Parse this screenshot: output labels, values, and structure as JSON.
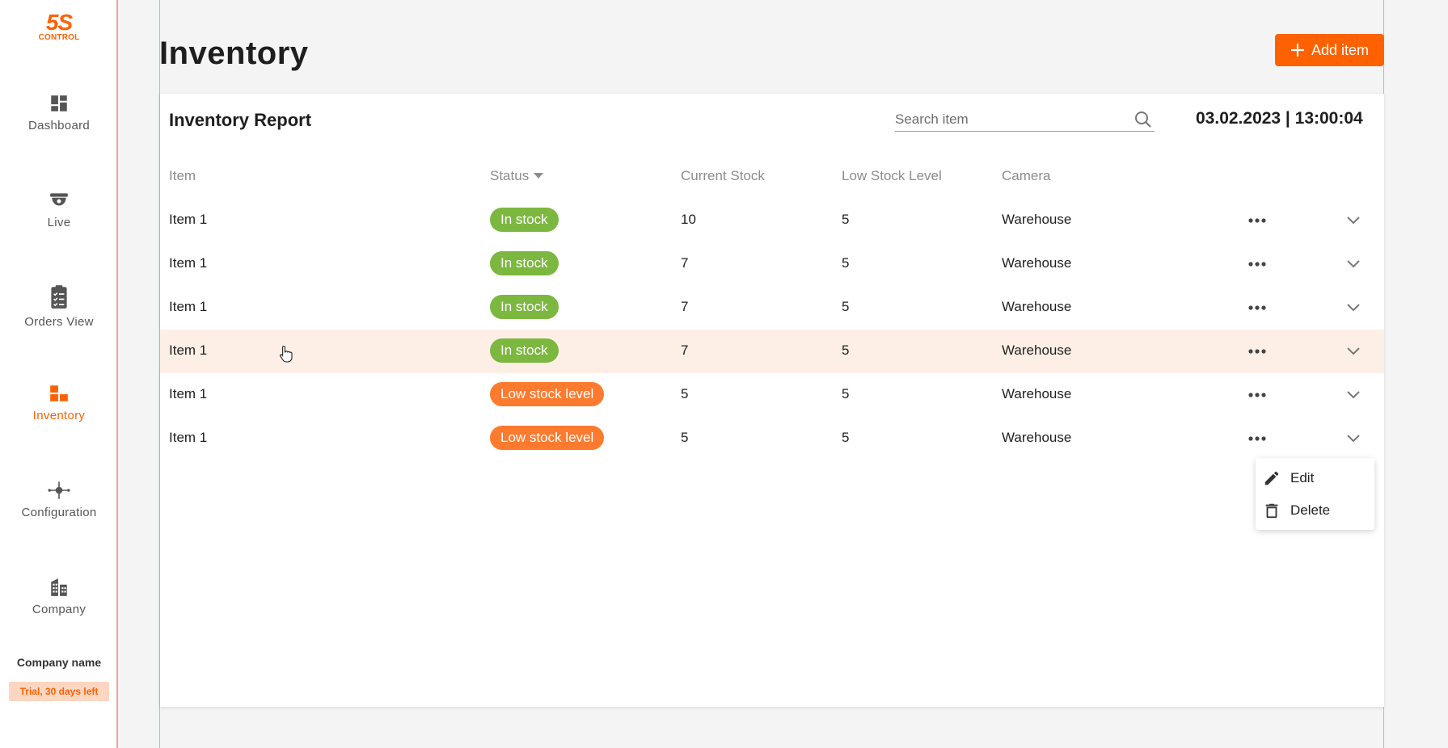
{
  "logo": {
    "main": "5S",
    "sub": "CONTROL"
  },
  "sidebar": {
    "items": [
      {
        "label": "Dashboard",
        "icon": "dashboard-icon"
      },
      {
        "label": "Live",
        "icon": "camera-icon"
      },
      {
        "label": "Orders View",
        "icon": "clipboard-icon"
      },
      {
        "label": "Inventory",
        "icon": "inventory-icon",
        "active": true
      },
      {
        "label": "Configuration",
        "icon": "configuration-icon"
      },
      {
        "label": "Company",
        "icon": "building-icon"
      }
    ],
    "company_name": "Company name",
    "trial": "Trial, 30 days left"
  },
  "header": {
    "title": "Inventory",
    "add_button": "Add item"
  },
  "report": {
    "title": "Inventory Report",
    "search_placeholder": "Search item",
    "datetime": "03.02.2023 | 13:00:04",
    "columns": [
      "Item",
      "Status",
      "Current Stock",
      "Low Stock Level",
      "Camera"
    ],
    "rows": [
      {
        "item": "Item 1",
        "status": "In stock",
        "status_type": "instock",
        "current": "10",
        "low": "5",
        "camera": "Warehouse"
      },
      {
        "item": "Item 1",
        "status": "In stock",
        "status_type": "instock",
        "current": "7",
        "low": "5",
        "camera": "Warehouse"
      },
      {
        "item": "Item 1",
        "status": "In stock",
        "status_type": "instock",
        "current": "7",
        "low": "5",
        "camera": "Warehouse"
      },
      {
        "item": "Item 1",
        "status": "In stock",
        "status_type": "instock",
        "current": "7",
        "low": "5",
        "camera": "Warehouse",
        "hover": true
      },
      {
        "item": "Item 1",
        "status": "Low stock level",
        "status_type": "low",
        "current": "5",
        "low": "5",
        "camera": "Warehouse"
      },
      {
        "item": "Item 1",
        "status": "Low stock level",
        "status_type": "low",
        "current": "5",
        "low": "5",
        "camera": "Warehouse"
      }
    ]
  },
  "menu": {
    "edit": "Edit",
    "delete": "Delete"
  },
  "colors": {
    "accent": "#fe6100",
    "instock": "#7cb740",
    "low": "#fe7a2e",
    "hover_row": "#fdefe6"
  }
}
